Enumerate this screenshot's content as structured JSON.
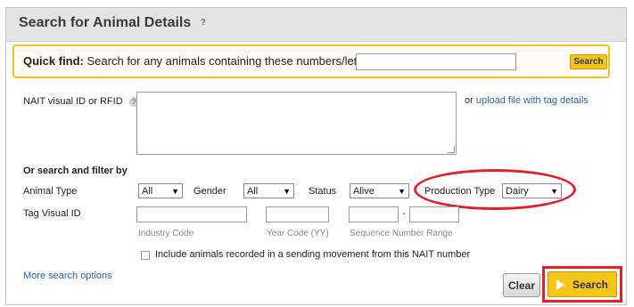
{
  "header": {
    "title": "Search for Animal Details",
    "help": "?"
  },
  "quick_find": {
    "label_bold": "Quick find:",
    "label_text": "Search for any animals containing these numbers/letters",
    "value": "",
    "button": "Search"
  },
  "nait": {
    "label": "NAIT visual ID or RFID",
    "help": "?",
    "value": "",
    "or_text": "or",
    "upload_link": "upload file with tag details"
  },
  "filters": {
    "heading": "Or search and filter by",
    "animal_type": {
      "label": "Animal Type",
      "value": "All"
    },
    "gender": {
      "label": "Gender",
      "value": "All"
    },
    "status": {
      "label": "Status",
      "value": "Alive"
    },
    "production_type": {
      "label": "Production Type",
      "value": "Dairy"
    }
  },
  "tag": {
    "label": "Tag Visual ID",
    "industry_code": "Industry Code",
    "year_code": "Year Code (YY)",
    "sequence_range": "Sequence Number Range",
    "dash": "-"
  },
  "checkbox_label": "Include animals recorded in a sending movement from this NAIT number",
  "more_options": "More search options",
  "buttons": {
    "clear": "Clear",
    "search": "Search"
  },
  "colors": {
    "accent_yellow": "#f5c518",
    "highlight_red": "#e0202a",
    "link_blue": "#2a5fb0"
  }
}
